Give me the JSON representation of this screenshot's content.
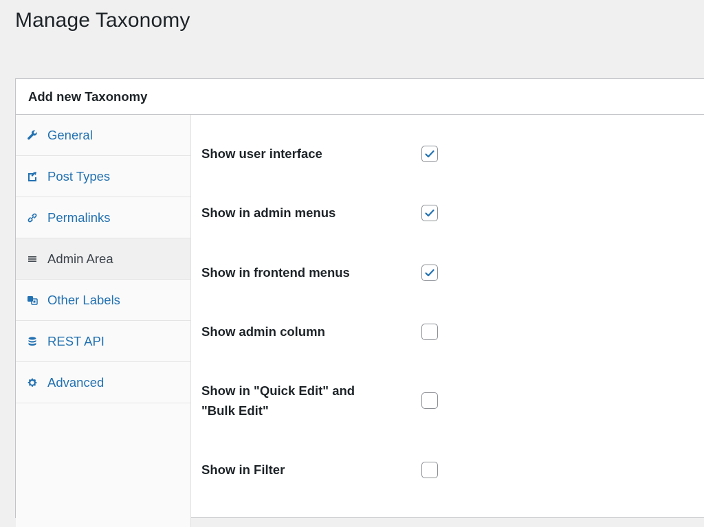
{
  "page": {
    "title": "Manage Taxonomy"
  },
  "panel": {
    "title": "Add new Taxonomy"
  },
  "tabs": [
    {
      "label": "General",
      "icon": "wrench-icon",
      "active": false
    },
    {
      "label": "Post Types",
      "icon": "post-types-icon",
      "active": false
    },
    {
      "label": "Permalinks",
      "icon": "link-icon",
      "active": false
    },
    {
      "label": "Admin Area",
      "icon": "menu-icon",
      "active": true
    },
    {
      "label": "Other Labels",
      "icon": "translation-icon",
      "active": false
    },
    {
      "label": "REST API",
      "icon": "database-icon",
      "active": false
    },
    {
      "label": "Advanced",
      "icon": "gear-icon",
      "active": false
    }
  ],
  "fields": [
    {
      "label": "Show user interface",
      "checked": true
    },
    {
      "label": "Show in admin menus",
      "checked": true
    },
    {
      "label": "Show in frontend menus",
      "checked": true
    },
    {
      "label": "Show admin column",
      "checked": false
    },
    {
      "label": "Show in \"Quick Edit\" and \"Bulk Edit\"",
      "checked": false
    },
    {
      "label": "Show in Filter",
      "checked": false
    }
  ],
  "colors": {
    "link": "#2271b1",
    "check": "#2271b1",
    "border": "#c3c4c7"
  }
}
